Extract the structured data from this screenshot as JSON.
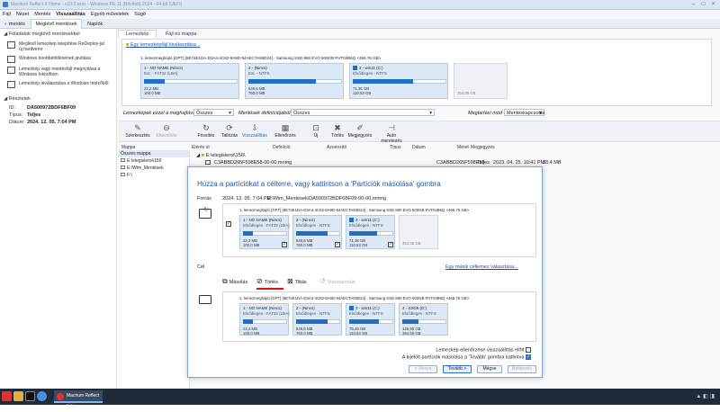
{
  "window": {
    "title": "Macrium Reflect X Home - v10.0.xxxx - Windows PE 11 (Bővített) 2024 - 64-bit (UEFI)"
  },
  "menu": [
    "Fájl",
    "Nézet",
    "Mentés",
    "Visszaállítás",
    "Egyéb műveletek",
    "Súgó"
  ],
  "menu_active": "Visszaállítás",
  "top_tabs": [
    "mentés",
    "Meglévő mentések",
    "Naplók"
  ],
  "sidebar": {
    "tasks_header": "Feladatok meglévő mentésekkel",
    "tasks": [
      "Meglévő lemezkép telepítése ReDeploy-jal új hardverre",
      "Windows boottbetöltésének javítása",
      "Lemezkép vagy mentésfájl megnyitása a Windows Intézőben",
      "Lemezkép leválasztása a Windows Intézőből"
    ],
    "details_header": "Részletek",
    "details": [
      {
        "k": "ID:",
        "v": "DA500972BDF6BF09"
      },
      {
        "k": "Típus:",
        "v": "Teljes"
      },
      {
        "k": "Dátum:",
        "v": "2024. 12. 05. 7:04 PM"
      }
    ]
  },
  "main_tabs": [
    "Lemezkép",
    "Fájl és mappa"
  ],
  "image_link": "Egy lemezképfájl kiválasztása...",
  "disk_header": "1. lemezmeghajtó [GPT] [8E74E1DA-D3A4-4C82-8A9D-94AECTA93D24] - Samsung SSD 860 EVO 500GB RVT04B6Q <465.76 GB>",
  "disk_parts": [
    {
      "title": "1 - NO NAME (Nincs)",
      "sub": "Ext. - FAT32 (LBA)",
      "used": "22,2 MB",
      "total": "100,0 MB",
      "fill": 0.22
    },
    {
      "title": "2 - (Nincs)",
      "sub": "Ext. - NTFS",
      "used": "549,6 MB",
      "total": "760,0 MB",
      "fill": 0.72
    },
    {
      "title": "3 - win11 (C:)",
      "sub": "Elsődleges - NTFS",
      "used": "71,36 GB",
      "total": "110,53 GB",
      "fill": 0.64
    }
  ],
  "disk_free": "354,85 GB",
  "filters": {
    "f1_label": "Lemezképek ezzel a meghajtóval",
    "f1_val": "Összes",
    "f2_label": "Mentések definíciójából",
    "f2_val": "Összes",
    "f3_label": "Megtartási mód",
    "f3_val": "Mentéskapcsolás"
  },
  "toolbar": [
    "Szerkesztés",
    "Eltávolítás",
    "Frissítés",
    "Tallózás",
    "Visszaállítás",
    "Ellenőrzés",
    "Új",
    "Törlés",
    "Megjegyzés",
    "Auto meretezés"
  ],
  "toolbar_disabled": [
    "Eltávolítás"
  ],
  "toolbar_active": "Visszaállítás",
  "tree_header": "Mappa",
  "tree": [
    "Összes mappa",
    "E:\\elegisleroi\\150",
    "E:\\Wim_Mentések",
    "F:\\"
  ],
  "list_cols": [
    "Elérés út",
    "Definíció",
    "Azonosító",
    "Típus",
    "Dátum",
    "Méret",
    "Megjegyzés"
  ],
  "list_group": "E:\\elegisleroi\\150\\",
  "list_rows": [
    {
      "name": "C3ABBD265F598E58-00-00.mrimg",
      "id": "C3ABBD265F598E58",
      "type": "Teljes",
      "date": "2023. 04. 25. 10:41 PM",
      "size": "38,4 MB"
    }
  ],
  "dialog": {
    "title": "Húzza a partíciókat a célterre, vagy kattintson a 'Partíciók másolása' gombra",
    "source_label": "Forrás",
    "source_date": "2024. 12. 05. 7:04 PM",
    "source_path": "E:\\Wim_Mentések\\DA500972BDF6BF09-00-00.mrimg",
    "src_disk": "1. lemezmeghajtó [GPT] [8E74E1DA-D3A4-4C82-8A9D-94AECTA93D24] - Samsung SSD 860 EVO 500GB RVT04B6Q <465.76 GB>",
    "src_parts": [
      {
        "title": "1 - NO NAME (Nincs)",
        "sub": "Elsődleges - FAT32 (LBA)",
        "used": "22,2 MB",
        "total": "100,0 MB",
        "fill": 0.22
      },
      {
        "title": "2 - (Nincs)",
        "sub": "Elsődleges - NTFS",
        "used": "549,6 MB",
        "total": "760,0 MB",
        "fill": 0.72
      },
      {
        "title": "3 - win11 (C:)",
        "sub": "Elsődleges - NTFS",
        "used": "71,36 GB",
        "total": "110,53 GB",
        "fill": 0.64
      }
    ],
    "src_free": "354,85 GB",
    "target_label": "Cél",
    "target_link": "Egy másik céllemez választása...",
    "ops": [
      "Másolás",
      "Törlés",
      "Tiltás",
      "Visszavonás"
    ],
    "ops_active": "Törlés",
    "dst_disk": "1. lemezmeghajtó [GPT] [8E74E1DA-D3A4-4C82-8A9D-94AECTA93D24] - Samsung SSD 860 EVO 500GB RVT04B6Q <465.76 GB>",
    "dst_parts": [
      {
        "title": "1 - NO NAME (Nincs)",
        "sub": "Elsődleges - FAT32 (LBA)",
        "used": "22,2 MB",
        "total": "100,0 MB",
        "fill": 0.22
      },
      {
        "title": "2 - (Nincs)",
        "sub": "Elsődleges - NTFS",
        "used": "549,6 MB",
        "total": "760,0 MB",
        "fill": 0.72
      },
      {
        "title": "3 - win11 (C:)",
        "sub": "Elsődleges - NTFS",
        "used": "75,46 GB",
        "total": "110,53 GB",
        "fill": 0.68
      },
      {
        "title": "4 - SSD5 (D:)",
        "sub": "Elsődleges - NTFS",
        "used": "126,95 GB",
        "total": "354,55 GB",
        "fill": 0.36
      }
    ],
    "check1": "Lemezkép ellenőrzése visszaállítás előtt",
    "check2": "A kijelölt partíciók másolása a 'Tovább' gombra kattintva",
    "buttons": [
      "< Vissza",
      "Tovább >",
      "Mégse",
      "Befejezés"
    ]
  },
  "taskbar": {
    "app": "Macrium Reflect X H..."
  }
}
